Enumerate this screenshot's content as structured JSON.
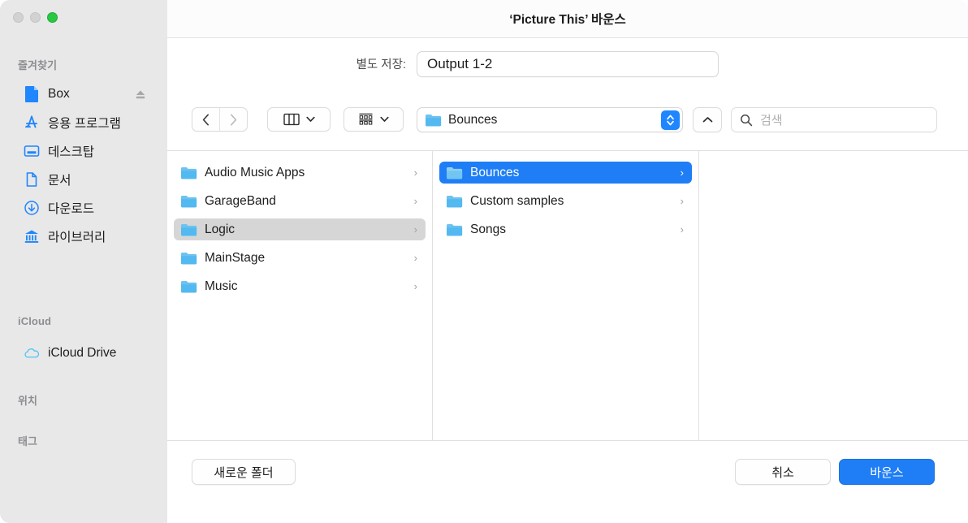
{
  "window": {
    "title": "‘Picture This’ 바운스",
    "traffic_lights": [
      {
        "name": "close",
        "color": "#d2d2d2"
      },
      {
        "name": "minimize",
        "color": "#d2d2d2"
      },
      {
        "name": "zoom",
        "color": "#28c840"
      }
    ]
  },
  "sidebar": {
    "sections": [
      {
        "header": "즐겨찾기",
        "items": [
          {
            "label": "Box",
            "icon": "document-blue-icon",
            "accessory": "eject-icon"
          },
          {
            "label": "응용 프로그램",
            "icon": "applications-icon"
          },
          {
            "label": "데스크탑",
            "icon": "desktop-icon"
          },
          {
            "label": "문서",
            "icon": "documents-icon"
          },
          {
            "label": "다운로드",
            "icon": "downloads-icon"
          },
          {
            "label": "라이브러리",
            "icon": "library-icon"
          }
        ]
      },
      {
        "header": "iCloud",
        "items": [
          {
            "label": "iCloud Drive",
            "icon": "icloud-icon"
          }
        ]
      },
      {
        "header": "위치",
        "items": []
      },
      {
        "header": "태그",
        "items": []
      }
    ]
  },
  "saveas": {
    "label": "별도 저장:",
    "filename": "Output 1-2"
  },
  "toolbar": {
    "back_icon": "chevron-left-icon",
    "forward_icon": "chevron-right-icon",
    "view_mode_icon": "column-view-icon",
    "view_mode_chevron": "chevron-down-icon",
    "arrange_icon": "grid-arrange-icon",
    "arrange_chevron": "chevron-down-icon",
    "path_folder_icon": "folder-icon",
    "path_label": "Bounces",
    "path_stepper_icon": "updown-stepper-icon",
    "disclosure_icon": "chevron-up-icon",
    "search_icon": "search-icon",
    "search_placeholder": "검색",
    "search_value": ""
  },
  "browser": {
    "columns": [
      {
        "name": "column-1",
        "rows": [
          {
            "label": "Audio Music Apps",
            "icon": "folder-icon",
            "chevron": "›",
            "state": "normal"
          },
          {
            "label": "GarageBand",
            "icon": "folder-icon",
            "chevron": "›",
            "state": "normal"
          },
          {
            "label": "Logic",
            "icon": "folder-icon",
            "chevron": "›",
            "state": "selected-inactive"
          },
          {
            "label": "MainStage",
            "icon": "folder-icon",
            "chevron": "›",
            "state": "normal"
          },
          {
            "label": "Music",
            "icon": "folder-icon",
            "chevron": "›",
            "state": "normal"
          }
        ]
      },
      {
        "name": "column-2",
        "rows": [
          {
            "label": "Bounces",
            "icon": "folder-icon",
            "chevron": "›",
            "state": "selected-active"
          },
          {
            "label": "Custom samples",
            "icon": "folder-icon",
            "chevron": "›",
            "state": "normal"
          },
          {
            "label": "Songs",
            "icon": "folder-icon",
            "chevron": "›",
            "state": "normal"
          }
        ]
      },
      {
        "name": "column-3",
        "rows": []
      }
    ]
  },
  "footer": {
    "new_folder_label": "새로운 폴더",
    "cancel_label": "취소",
    "confirm_label": "바운스"
  },
  "colors": {
    "accent": "#1f7ef5",
    "stepper": "#1f86fe",
    "sidebar_bg": "#e8e8e8",
    "folder_blue": "#53b9f0",
    "zoom_green": "#28c840"
  }
}
